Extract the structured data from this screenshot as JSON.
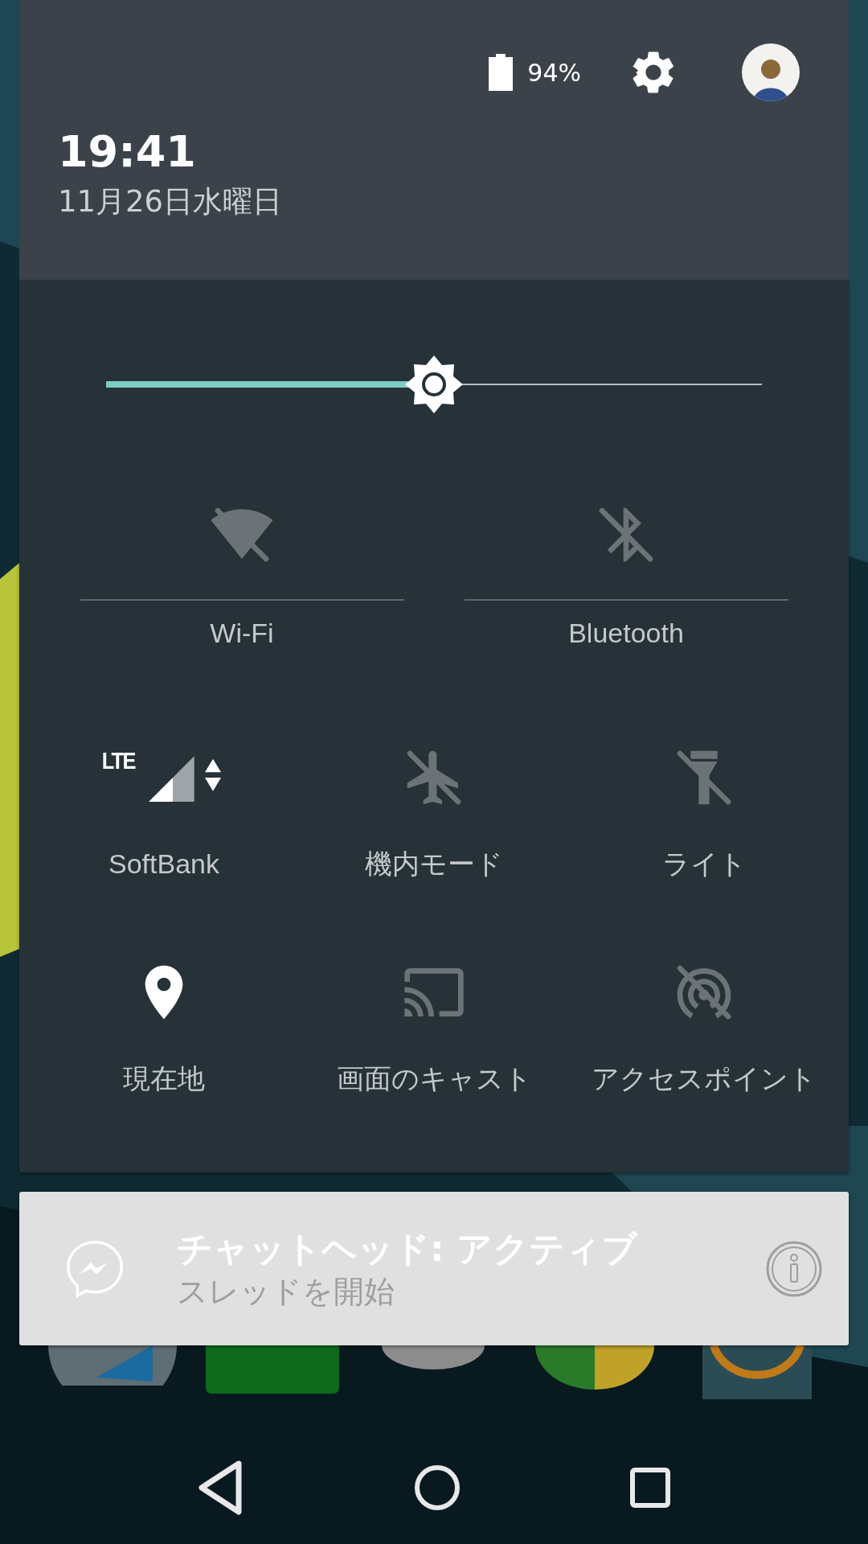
{
  "header": {
    "battery": "94%",
    "time": "19:41",
    "date": "11月26日水曜日"
  },
  "brightness": {
    "level": 0.5
  },
  "tile_rows": [
    {
      "kind": "large",
      "tiles": [
        {
          "kind": "wifi",
          "label": "Wi-Fi",
          "on": false
        },
        {
          "kind": "bluetooth",
          "label": "Bluetooth",
          "on": false
        }
      ]
    },
    {
      "kind": "small",
      "tiles": [
        {
          "kind": "cellular",
          "badge": "LTE",
          "label": "SoftBank",
          "on": true
        },
        {
          "kind": "airplane",
          "label": "機内モード",
          "on": false
        },
        {
          "kind": "flashlight",
          "label": "ライト",
          "on": false
        }
      ]
    },
    {
      "kind": "small",
      "tiles": [
        {
          "kind": "location",
          "label": "現在地",
          "on": true
        },
        {
          "kind": "cast",
          "label": "画面のキャスト",
          "on": false
        },
        {
          "kind": "hotspot",
          "label": "アクセスポイント",
          "on": false
        }
      ]
    }
  ],
  "notification": {
    "title": "チャットヘッド: アクティブ",
    "text": "スレッドを開始"
  }
}
